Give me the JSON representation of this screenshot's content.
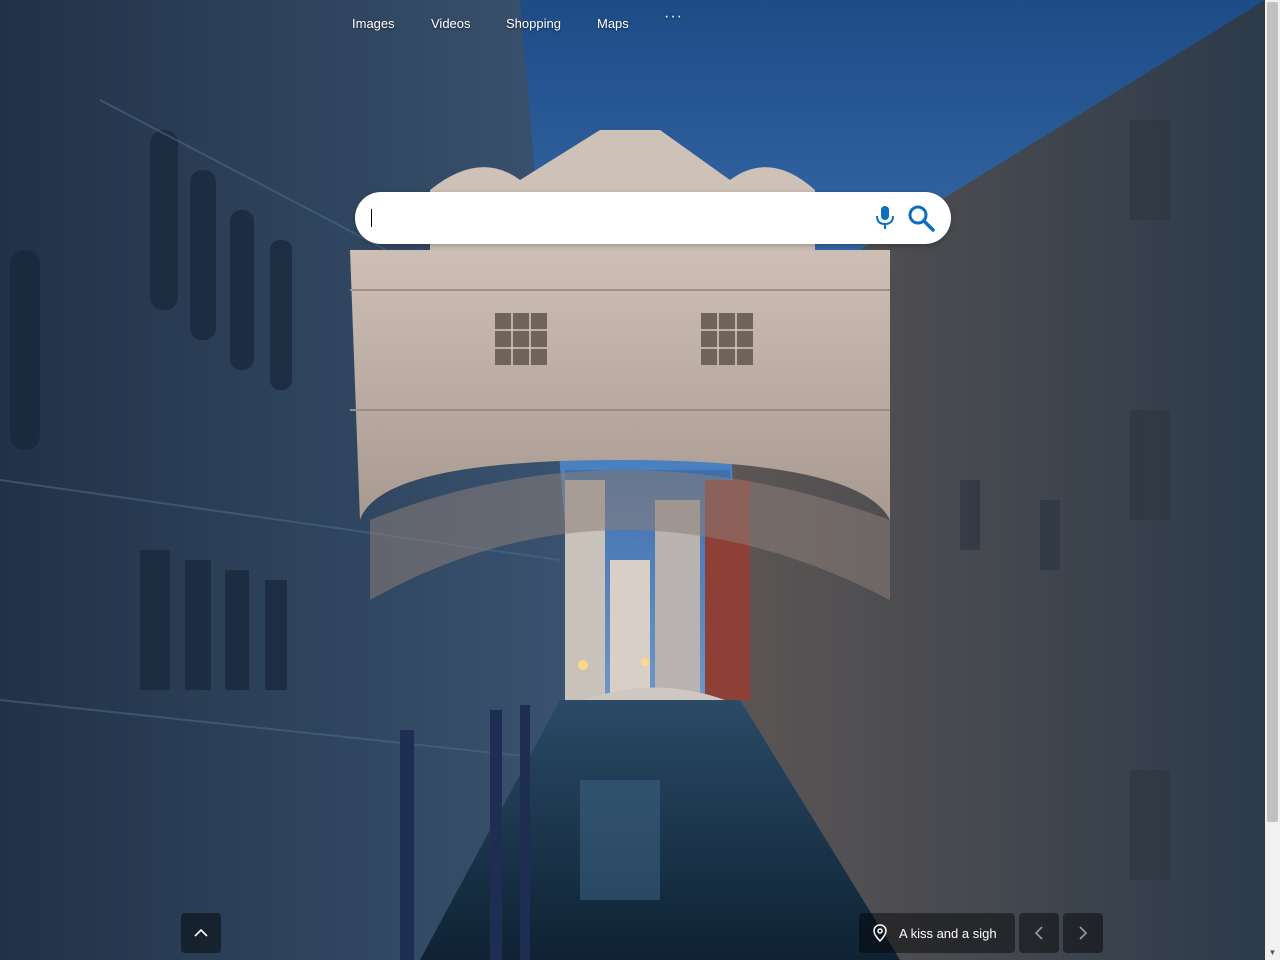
{
  "nav": {
    "items": [
      {
        "label": "Images"
      },
      {
        "label": "Videos"
      },
      {
        "label": "Shopping"
      },
      {
        "label": "Maps"
      }
    ],
    "more_label": "···"
  },
  "search": {
    "value": "",
    "mic_icon": "microphone-icon",
    "search_icon": "magnifier-icon"
  },
  "footer": {
    "scroll_up_icon": "chevron-up-icon",
    "location_icon": "map-pin-icon",
    "location_label": "A kiss and a sigh",
    "prev_icon": "chevron-left-icon",
    "next_icon": "chevron-right-icon"
  },
  "colors": {
    "accent": "#0c6ec0",
    "sky": "#3f78b8",
    "stone": "#c9b9ad"
  }
}
